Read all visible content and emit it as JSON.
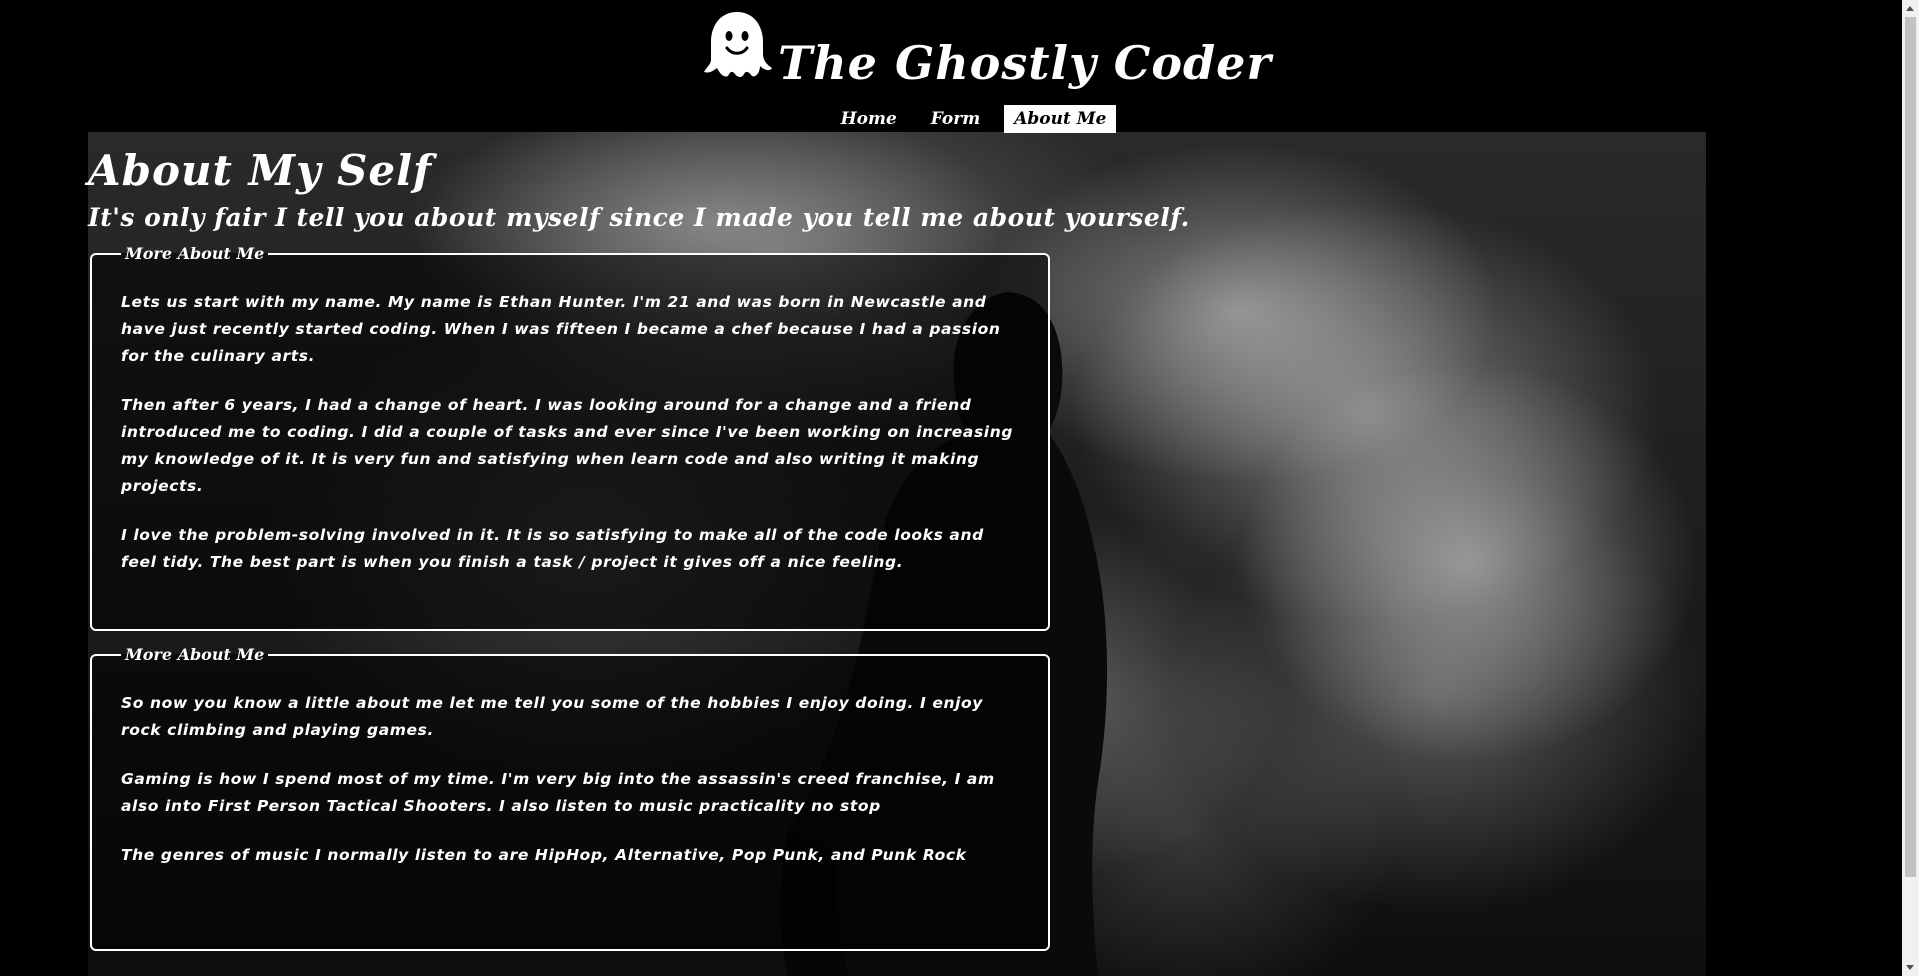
{
  "header": {
    "site_title": "The Ghostly Coder",
    "logo_icon": "ghost-icon",
    "nav": [
      {
        "label": "Home",
        "active": false
      },
      {
        "label": "Form",
        "active": false
      },
      {
        "label": "About Me",
        "active": true
      }
    ]
  },
  "main": {
    "heading": "About My Self",
    "subheading": "It's only fair I tell you about myself since I made you tell me about yourself.",
    "sections": [
      {
        "legend": "More About Me",
        "paragraphs": [
          "Lets us start with my name. My name is Ethan Hunter. I'm 21 and was born in Newcastle and have just recently started coding. When I was fifteen I became a chef because I had a passion for the culinary arts.",
          "Then after 6 years, I had a change of heart. I was looking around for a change and a friend introduced me to coding. I did a couple of tasks and ever since I've been working on increasing my knowledge of it. It is very fun and satisfying when learn code and also writing it making projects.",
          "I love the problem-solving involved in it. It is so satisfying to make all of the code looks and feel tidy. The best part is when you finish a task / project it gives off a nice feeling."
        ]
      },
      {
        "legend": "More About Me",
        "paragraphs": [
          "So now you know a little about me let me tell you some of the hobbies I enjoy doing. I enjoy rock climbing and playing games.",
          "Gaming is how I spend most of my time. I'm very big into the assassin's creed franchise, I am also into First Person Tactical Shooters. I also listen to music practicality no stop",
          "The genres of music I normally listen to are HipHop, Alternative, Pop Punk, and Punk Rock"
        ]
      }
    ]
  },
  "colors": {
    "background": "#000000",
    "text": "#ffffff",
    "nav_active_bg": "#ffffff",
    "nav_active_text": "#000000"
  }
}
